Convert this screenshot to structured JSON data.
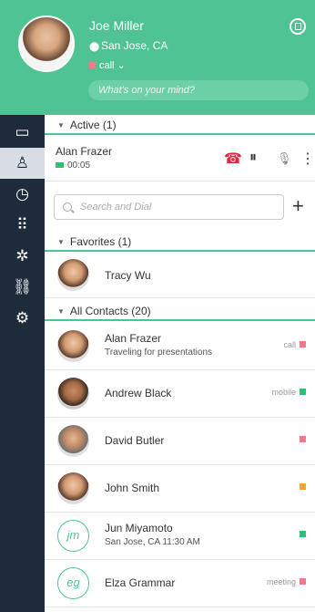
{
  "user": {
    "name": "Joe Miller",
    "location": "San Jose, CA",
    "status": "call",
    "status_color": "#f07a8a",
    "mind_placeholder": "What's on your mind?"
  },
  "sidebar": {
    "items": [
      {
        "name": "chat",
        "icon": "chat-bubble-icon",
        "glyph": "▭"
      },
      {
        "name": "contacts",
        "icon": "person-icon",
        "glyph": "♙"
      },
      {
        "name": "history",
        "icon": "clock-icon",
        "glyph": "◷"
      },
      {
        "name": "dialpad",
        "icon": "dialpad-icon",
        "glyph": "⠿"
      },
      {
        "name": "network",
        "icon": "network-icon",
        "glyph": "✲"
      },
      {
        "name": "link",
        "icon": "link-icon",
        "glyph": "⛓"
      },
      {
        "name": "settings",
        "icon": "gear-icon",
        "glyph": "⚙"
      }
    ]
  },
  "active": {
    "header": "Active (1)",
    "caller": "Alan Frazer",
    "time": "00:05",
    "actions": [
      {
        "icon": "hangup-icon",
        "glyph": "☎",
        "color": "#e0283b"
      },
      {
        "icon": "pause-icon",
        "glyph": "⏸",
        "color": "#333"
      },
      {
        "icon": "mute-mic-icon",
        "glyph": "🎙",
        "color": "#888"
      },
      {
        "icon": "more-icon",
        "glyph": "⋮",
        "color": "#333"
      }
    ]
  },
  "search": {
    "placeholder": "Search and Dial",
    "add_label": "+"
  },
  "favorites": {
    "header": "Favorites (1)",
    "items": [
      {
        "name": "Tracy Wu"
      }
    ]
  },
  "contacts": {
    "header": "All Contacts (20)",
    "items": [
      {
        "name": "Alan Frazer",
        "sub": "Traveling for presentations",
        "tag": "call",
        "tag_color": "#f07a8a",
        "avatar": ""
      },
      {
        "name": "Andrew Black",
        "sub": "",
        "tag": "mobile",
        "tag_color": "#2ec074",
        "avatar": ""
      },
      {
        "name": "David Butler",
        "sub": "",
        "tag": "",
        "tag_color": "#f07a8a",
        "avatar": ""
      },
      {
        "name": "John Smith",
        "sub": "",
        "tag": "",
        "tag_color": "#f2a23a",
        "avatar": ""
      },
      {
        "name": "Jun Miyamoto",
        "sub": "San Jose, CA 11:30 AM",
        "tag": "",
        "tag_color": "#2ec074",
        "avatar": "jm"
      },
      {
        "name": "Elza Grammar",
        "sub": "",
        "tag": "meeting",
        "tag_color": "#f07a8a",
        "avatar": "eg"
      }
    ]
  }
}
